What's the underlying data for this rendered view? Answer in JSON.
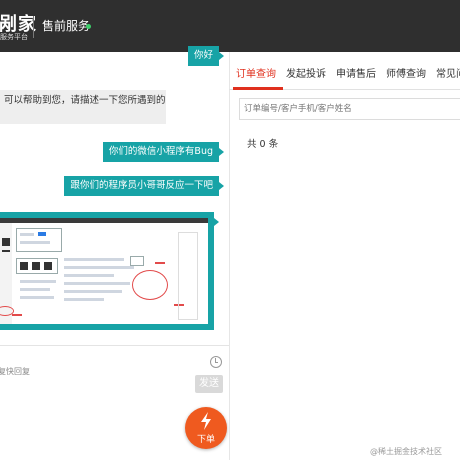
{
  "header": {
    "logo_text": "剐家",
    "logo_sub": "服务平台",
    "service_title": "售前服务"
  },
  "chat": {
    "messages": [
      {
        "side": "right",
        "text": "你好"
      },
      {
        "side": "left",
        "text": "可以帮助到您，请描述一下您所遇到的"
      },
      {
        "side": "right",
        "text": "你们的微信小程序有Bug"
      },
      {
        "side": "right",
        "text": "跟你们的程序员小哥哥反应一下吧"
      },
      {
        "side": "right",
        "type": "image"
      }
    ],
    "quick_reply_label": "复快回复",
    "send_label": "发送",
    "order_label": "下单"
  },
  "panel": {
    "tabs": [
      {
        "label": "订单查询",
        "active": true
      },
      {
        "label": "发起投诉",
        "active": false
      },
      {
        "label": "申请售后",
        "active": false
      },
      {
        "label": "师傅查询",
        "active": false
      },
      {
        "label": "常见问",
        "active": false
      }
    ],
    "search_placeholder": "订单编号/客户手机/客户姓名",
    "count_text": "共 0 条"
  },
  "colors": {
    "header_bg": "#2f2f2f",
    "bubble": "#17a3a6",
    "active_tab": "#e0301e",
    "order_button": "#ef5a1f",
    "online": "#3dcf6b"
  },
  "watermark": "@稀土掘金技术社区"
}
